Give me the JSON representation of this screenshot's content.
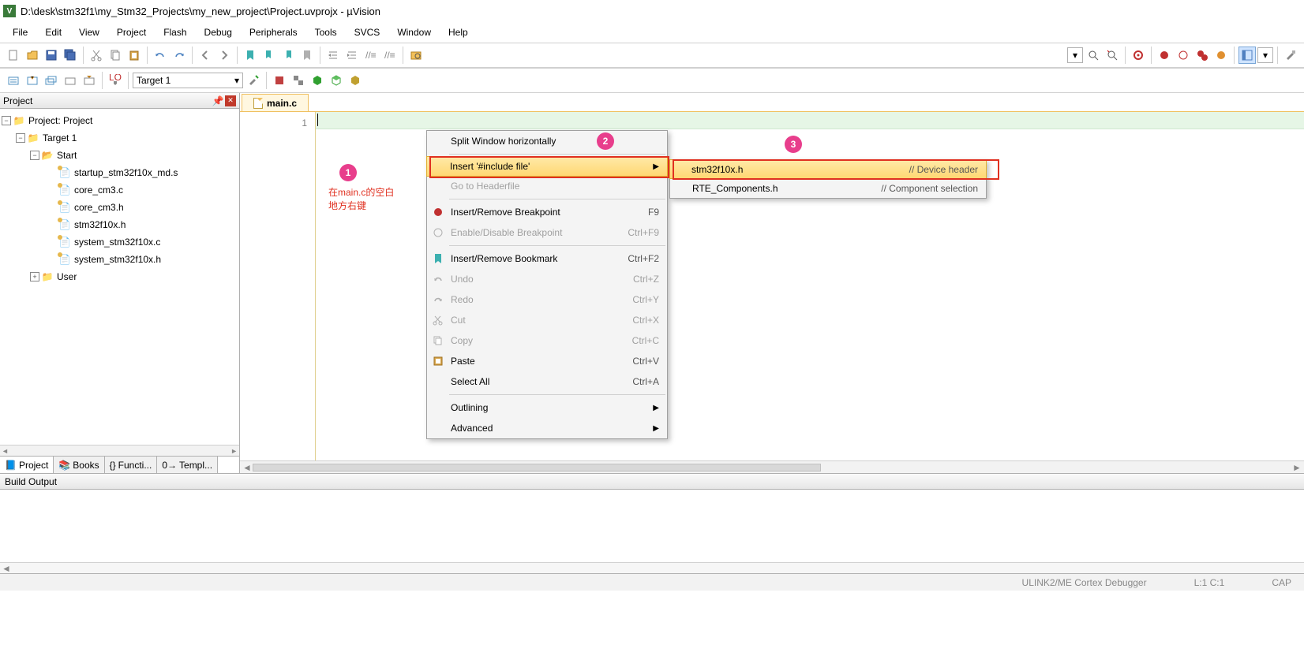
{
  "title": "D:\\desk\\stm32f1\\my_Stm32_Projects\\my_new_project\\Project.uvprojx - µVision",
  "menu": [
    "File",
    "Edit",
    "View",
    "Project",
    "Flash",
    "Debug",
    "Peripherals",
    "Tools",
    "SVCS",
    "Window",
    "Help"
  ],
  "target_combo": "Target 1",
  "project_panel": {
    "title": "Project",
    "root": "Project: Project",
    "target": "Target 1",
    "groups": [
      {
        "name": "Start",
        "files": [
          "startup_stm32f10x_md.s",
          "core_cm3.c",
          "core_cm3.h",
          "stm32f10x.h",
          "system_stm32f10x.c",
          "system_stm32f10x.h"
        ]
      },
      {
        "name": "User",
        "files": []
      }
    ],
    "tabs": [
      "Project",
      "Books",
      "Functi...",
      "Templ..."
    ]
  },
  "editor": {
    "active_tab": "main.c",
    "line_number": "1"
  },
  "context_menu": [
    {
      "label": "Split Window horizontally",
      "enabled": true
    },
    {
      "sep": true
    },
    {
      "label": "Insert '#include file'",
      "enabled": true,
      "highlight": true,
      "submenu": true
    },
    {
      "label": "Go to Headerfile",
      "enabled": false
    },
    {
      "sep": true
    },
    {
      "label": "Insert/Remove Breakpoint",
      "shortcut": "F9",
      "enabled": true,
      "icon": "breakpoint"
    },
    {
      "label": "Enable/Disable Breakpoint",
      "shortcut": "Ctrl+F9",
      "enabled": false,
      "icon": "bp-disable"
    },
    {
      "sep": true
    },
    {
      "label": "Insert/Remove Bookmark",
      "shortcut": "Ctrl+F2",
      "enabled": true,
      "icon": "bookmark"
    },
    {
      "label": "Undo",
      "shortcut": "Ctrl+Z",
      "enabled": false,
      "icon": "undo"
    },
    {
      "label": "Redo",
      "shortcut": "Ctrl+Y",
      "enabled": false,
      "icon": "redo"
    },
    {
      "label": "Cut",
      "shortcut": "Ctrl+X",
      "enabled": false,
      "icon": "cut"
    },
    {
      "label": "Copy",
      "shortcut": "Ctrl+C",
      "enabled": false,
      "icon": "copy"
    },
    {
      "label": "Paste",
      "shortcut": "Ctrl+V",
      "enabled": true,
      "icon": "paste"
    },
    {
      "label": "Select All",
      "shortcut": "Ctrl+A",
      "enabled": true
    },
    {
      "sep": true
    },
    {
      "label": "Outlining",
      "enabled": true,
      "submenu": true
    },
    {
      "label": "Advanced",
      "enabled": true,
      "submenu": true
    }
  ],
  "submenu": [
    {
      "file": "stm32f10x.h",
      "comment": "// Device header",
      "highlight": true
    },
    {
      "file": "RTE_Components.h",
      "comment": "// Component selection"
    }
  ],
  "build_output": {
    "title": "Build Output"
  },
  "status": {
    "debugger": "ULINK2/ME Cortex Debugger",
    "pos": "L:1 C:1",
    "cap": "CAP"
  },
  "annotations": {
    "badge1": "1",
    "badge2": "2",
    "badge3": "3",
    "text1a": "在main.c的空白",
    "text1b": "地方右键"
  }
}
